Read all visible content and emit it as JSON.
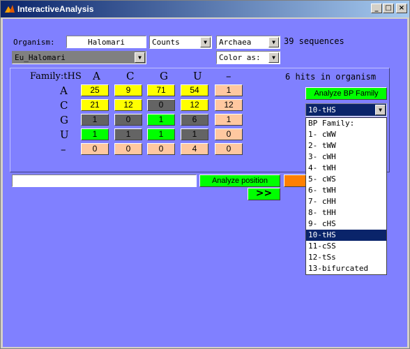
{
  "window": {
    "title": "InteractiveAnalysis",
    "buttons": {
      "minimize": "_",
      "maximize": "□",
      "close": "×"
    }
  },
  "controls": {
    "organism_label": "Organism:",
    "organism_value": "Halomari",
    "counts_select": "Counts",
    "domain_select": "Archaea",
    "sequences_text": "39 sequences",
    "species_select": "Eu_Halomari",
    "color_select": "Color as:"
  },
  "matrix": {
    "corner_label": "Family:tHS",
    "col_headers": [
      "A",
      "C",
      "G",
      "U",
      "–"
    ],
    "row_headers": [
      "A",
      "C",
      "G",
      "U",
      "–"
    ],
    "hits_text": "6 hits in organism",
    "rows": [
      [
        {
          "v": "25",
          "c": "#ffff00"
        },
        {
          "v": "9",
          "c": "#ffff00"
        },
        {
          "v": "71",
          "c": "#ffff00"
        },
        {
          "v": "54",
          "c": "#ffff00"
        },
        {
          "v": "1",
          "c": "#ffc8a0"
        }
      ],
      [
        {
          "v": "21",
          "c": "#ffff00"
        },
        {
          "v": "12",
          "c": "#ffff00"
        },
        {
          "v": "0",
          "c": "#646464"
        },
        {
          "v": "12",
          "c": "#ffff00"
        },
        {
          "v": "12",
          "c": "#ffc8a0"
        }
      ],
      [
        {
          "v": "1",
          "c": "#646464"
        },
        {
          "v": "0",
          "c": "#646464"
        },
        {
          "v": "1",
          "c": "#00ff00"
        },
        {
          "v": "6",
          "c": "#646464"
        },
        {
          "v": "1",
          "c": "#ffc8a0"
        }
      ],
      [
        {
          "v": "1",
          "c": "#00ff00"
        },
        {
          "v": "1",
          "c": "#646464"
        },
        {
          "v": "1",
          "c": "#00ff00"
        },
        {
          "v": "1",
          "c": "#646464"
        },
        {
          "v": "0",
          "c": "#ffc8a0"
        }
      ],
      [
        {
          "v": "0",
          "c": "#ffc8a0"
        },
        {
          "v": "0",
          "c": "#ffc8a0"
        },
        {
          "v": "0",
          "c": "#ffc8a0"
        },
        {
          "v": "4",
          "c": "#ffc8a0"
        },
        {
          "v": "0",
          "c": "#ffc8a0"
        }
      ]
    ]
  },
  "bp_panel": {
    "analyze_bp_label": "Analyze BP Family",
    "family_select": "10-tHS",
    "list": [
      "BP Family:",
      "1- cWW",
      "2- tWW",
      "3- cWH",
      "4- tWH",
      "5- cWS",
      "6- tWH",
      "7- cHH",
      "8- tHH",
      "9- cHS",
      "10-tHS",
      "11-cSS",
      "12-tSs",
      "13-bifurcated"
    ],
    "selected_index": 10
  },
  "bottom": {
    "position_value": "",
    "analyze_position_label": "Analyze position",
    "next_label": ">>"
  },
  "colors": {
    "background": "#8080ff",
    "green_button": "#00ff00",
    "orange_button": "#ff8000",
    "selection": "#0a246a"
  }
}
